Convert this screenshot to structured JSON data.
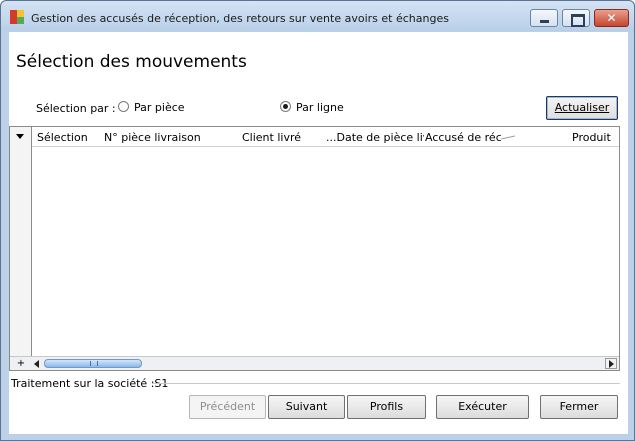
{
  "window": {
    "title": "Gestion des accusés de réception, des retours sur vente avoirs et échanges",
    "close_glyph": "✕"
  },
  "page": {
    "title": "Sélection des mouvements"
  },
  "selection": {
    "label": "Sélection par :",
    "options": [
      {
        "label": "Par pièce",
        "selected": false
      },
      {
        "label": "Par ligne",
        "selected": true
      }
    ],
    "refresh_label": "Actualiser"
  },
  "grid": {
    "columns": [
      "Sélection",
      "N° pièce livraison",
      "Client livré",
      "...Date de pièce liv...",
      "Accusé de réce",
      "Produit"
    ],
    "rows": [],
    "plus_label": "+",
    "grip_glyph": "|||"
  },
  "status": {
    "text": "Traitement sur la société :S1"
  },
  "footer": {
    "prev_label": "Précédent",
    "next_label": "Suivant",
    "profiles_label": "Profils",
    "execute_label": "Exécuter",
    "close_label": "Fermer"
  },
  "colors": {
    "accent": "#1f3a5c",
    "titlebar": "#bcd0e7"
  }
}
